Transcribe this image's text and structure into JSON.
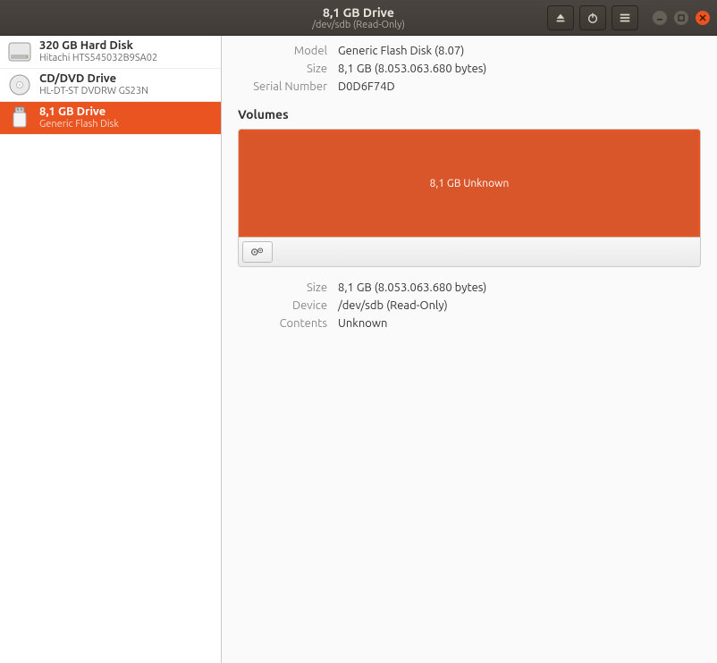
{
  "titlebar": {
    "title": "8,1 GB Drive",
    "subtitle": "/dev/sdb (Read-Only)"
  },
  "sidebar": {
    "drives": [
      {
        "title": "320 GB Hard Disk",
        "subtitle": "Hitachi HTS545032B9SA02",
        "type": "hdd",
        "selected": false
      },
      {
        "title": "CD/DVD Drive",
        "subtitle": "HL-DT-ST DVDRW  GS23N",
        "type": "optical",
        "selected": false
      },
      {
        "title": "8,1 GB Drive",
        "subtitle": "Generic Flash Disk",
        "type": "usb",
        "selected": true
      }
    ]
  },
  "details": {
    "model_label": "Model",
    "model_value": "Generic Flash Disk (8.07)",
    "size_label": "Size",
    "size_value": "8,1 GB (8.053.063.680 bytes)",
    "serial_label": "Serial Number",
    "serial_value": "D0D6F74D"
  },
  "volumes": {
    "header": "Volumes",
    "block_label": "8,1 GB Unknown"
  },
  "volume_details": {
    "size_label": "Size",
    "size_value": "8,1 GB (8.053.063.680 bytes)",
    "device_label": "Device",
    "device_value": "/dev/sdb (Read-Only)",
    "contents_label": "Contents",
    "contents_value": "Unknown"
  }
}
